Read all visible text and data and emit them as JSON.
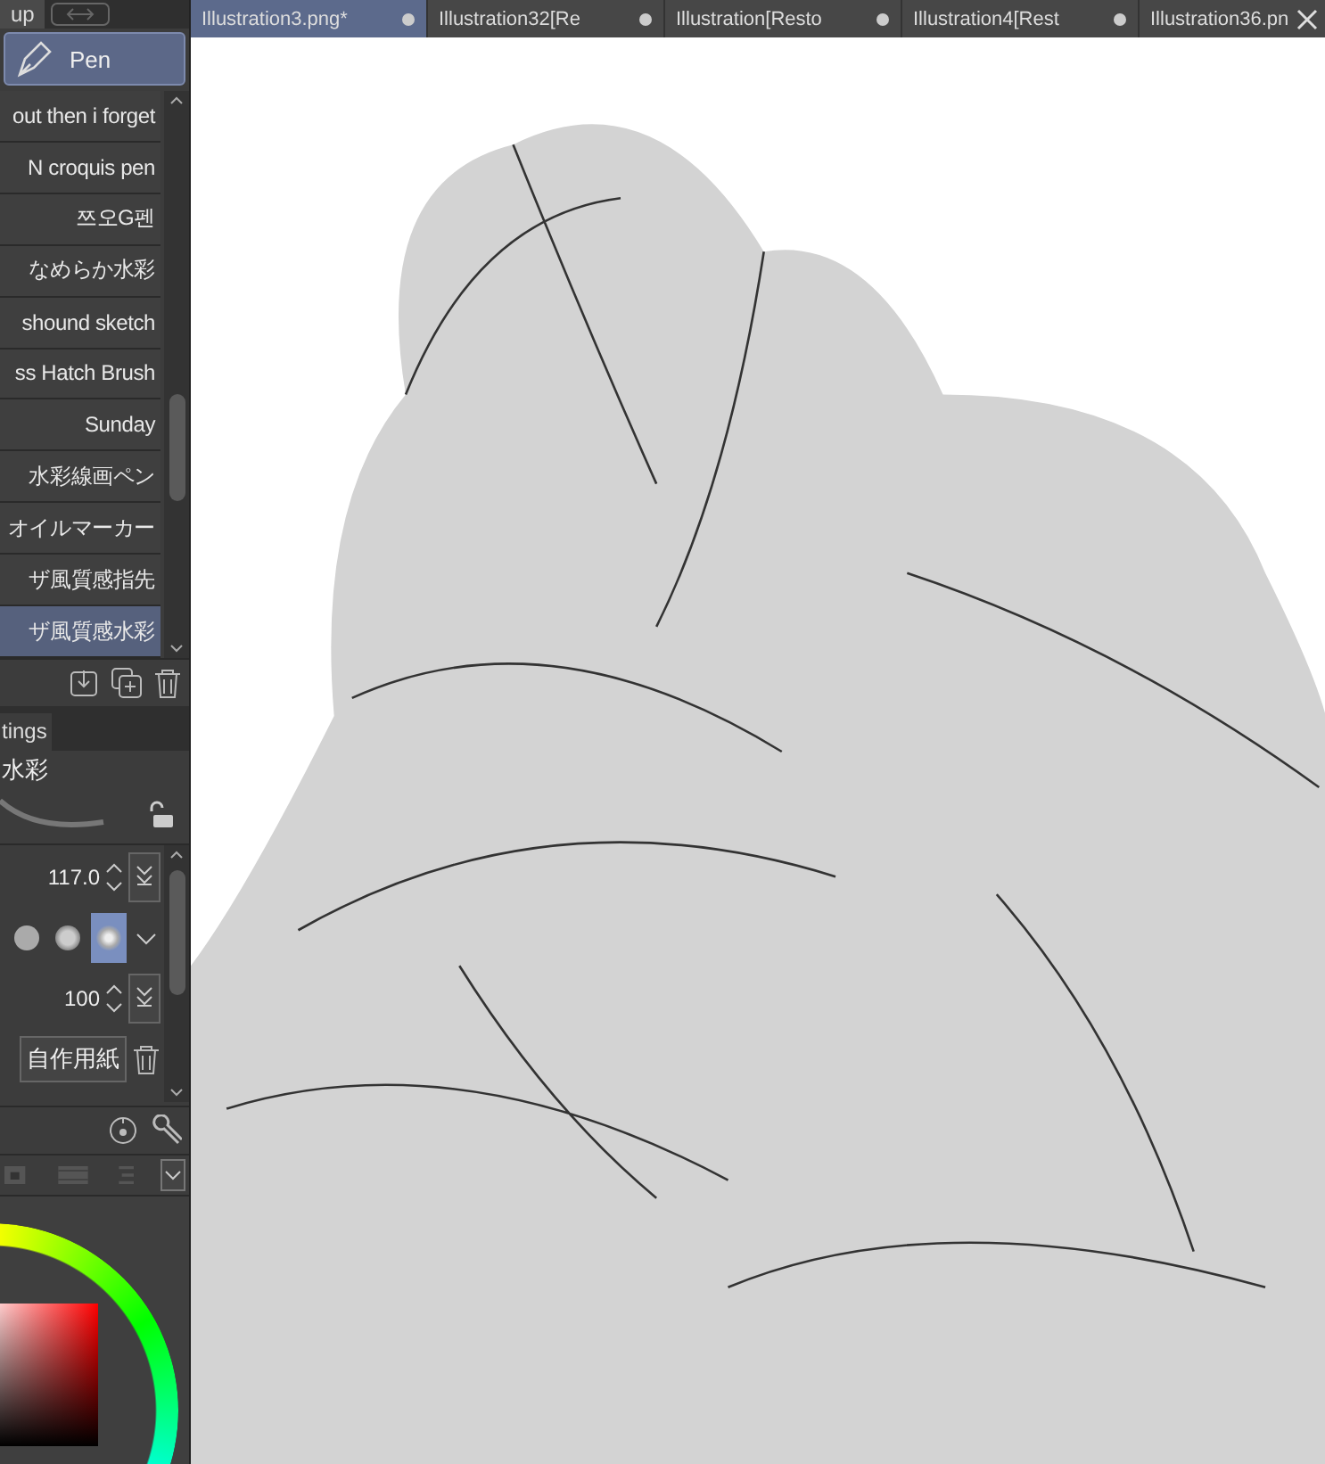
{
  "left_panel": {
    "tabs": [
      {
        "label": "up"
      }
    ],
    "tool_button": "Pen",
    "brushes": [
      {
        "name": "out then i forget",
        "selected": false
      },
      {
        "name": "N croquis pen",
        "selected": false
      },
      {
        "name": "쯔오G펜",
        "selected": false
      },
      {
        "name": "なめらか水彩",
        "selected": false
      },
      {
        "name": "shound sketch",
        "selected": false
      },
      {
        "name": "ss Hatch Brush",
        "selected": false
      },
      {
        "name": "Sunday",
        "selected": false
      },
      {
        "name": "水彩線画ペン",
        "selected": false
      },
      {
        "name": "オイルマーカー",
        "selected": false
      },
      {
        "name": "ザ風質感指先",
        "selected": false
      },
      {
        "name": "ザ風質感水彩",
        "selected": true
      }
    ],
    "settings_tab": "tings",
    "brush_name": "水彩",
    "size": "117.0",
    "tip_shapes": [
      {
        "selected": false
      },
      {
        "selected": false
      },
      {
        "selected": true
      }
    ],
    "opacity": "100",
    "paper_button": "自作用紙"
  },
  "document_tabs": [
    {
      "label": "Illustration3.png*",
      "selected": true,
      "kind": "dot"
    },
    {
      "label": "Illustration32[Re",
      "selected": false,
      "kind": "dot"
    },
    {
      "label": "Illustration[Resto",
      "selected": false,
      "kind": "dot"
    },
    {
      "label": "Illustration4[Rest",
      "selected": false,
      "kind": "dot"
    },
    {
      "label": "Illustration36.pn",
      "selected": false,
      "kind": "close"
    }
  ]
}
